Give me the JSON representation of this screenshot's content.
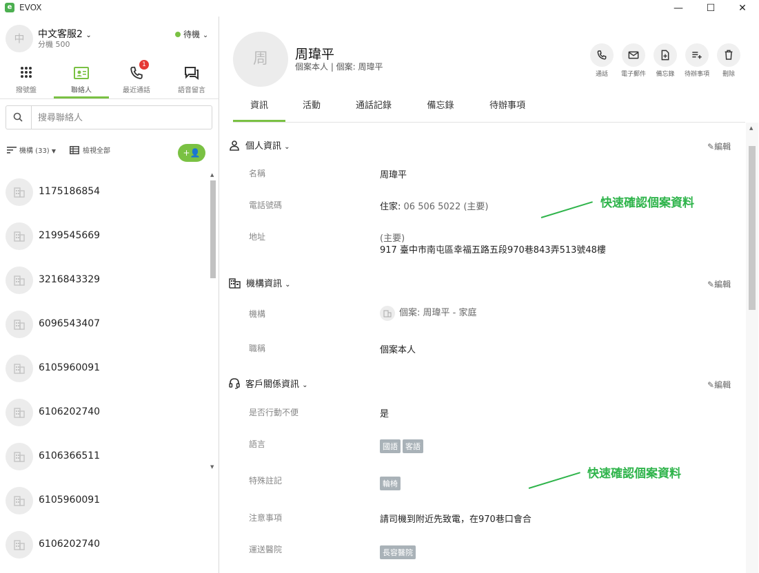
{
  "app": {
    "name": "EVOX",
    "logo_letter": "e"
  },
  "window": {
    "minimize": "—",
    "maximize": "☐",
    "close": "✕"
  },
  "user": {
    "avatar_text": "中",
    "name": "中文客服2",
    "ext": "分機 500",
    "status": "待機"
  },
  "nav": {
    "dialpad": "撥號盤",
    "contacts": "聯絡人",
    "recent": "最近通話",
    "voicemail": "語音留言",
    "recent_badge": "1"
  },
  "search": {
    "placeholder": "搜尋聯絡人"
  },
  "filter": {
    "org_label": "機構 (33)",
    "view_all": "檢視全部",
    "add_icon": "+👤"
  },
  "contacts": [
    "1175186854",
    "2199545669",
    "3216843329",
    "6096543407",
    "6105960091",
    "6106202740",
    "6106366511",
    "6105960091",
    "6106202740"
  ],
  "case": {
    "avatar_text": "周",
    "name": "周瑋平",
    "subtitle": "個案本人 | 個案: 周瑋平"
  },
  "actions": {
    "call": "通話",
    "email": "電子郵件",
    "memo": "備忘錄",
    "todo": "待辦事項",
    "delete": "刪除"
  },
  "tabs": {
    "info": "資訊",
    "activity": "活動",
    "call_log": "通話記錄",
    "memo": "備忘錄",
    "todo": "待辦事項"
  },
  "personal": {
    "title": "個人資訊",
    "edit": "編輯",
    "name_label": "名稱",
    "name_value": "周瑋平",
    "phone_label": "電話號碼",
    "phone_prefix": "住家: ",
    "phone_value": "06 506 5022 (主要)",
    "address_label": "地址",
    "address_tag": "(主要)",
    "address_value": "917 臺中市南屯區幸福五路五段970巷843弄513號48樓"
  },
  "org": {
    "title": "機構資訊",
    "edit": "編輯",
    "org_label": "機構",
    "org_value": "個案: 周瑋平 - 家庭",
    "role_label": "職稱",
    "role_value": "個案本人"
  },
  "crm": {
    "title": "客戶關係資訊",
    "edit": "編輯",
    "mobility_label": "是否行動不便",
    "mobility_value": "是",
    "language_label": "語言",
    "languages": [
      "國語",
      "客語"
    ],
    "special_label": "特殊註記",
    "special_tag": "輪椅",
    "notice_label": "注意事項",
    "notice_value": "請司機到附近先致電，在970巷口會合",
    "hospital_label": "運送醫院",
    "hospital_tag": "長容醫院"
  },
  "annotations": {
    "top": "快速確認個案資料",
    "bottom": "快速確認個案資料"
  },
  "colors": {
    "accent": "#7ac143",
    "annotation": "#2fb44b",
    "badge": "#e53935",
    "tag": "#a9b2b8"
  }
}
